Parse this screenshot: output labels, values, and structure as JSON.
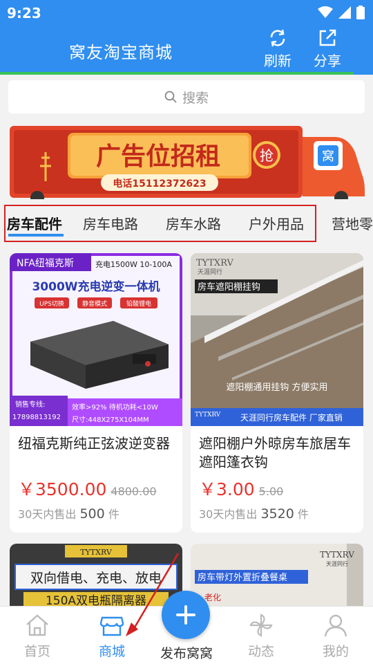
{
  "status": {
    "time": "9:23"
  },
  "header": {
    "title": "窝友淘宝商城",
    "refresh_label": "刷新",
    "share_label": "分享"
  },
  "search": {
    "placeholder": "搜索"
  },
  "banner": {
    "headline": "广告位招租",
    "phone": "电话15112372623",
    "grab": "抢",
    "badge": "窝"
  },
  "categories": [
    "房车配件",
    "房车电路",
    "房车水路",
    "户外用品",
    "营地零"
  ],
  "products": [
    {
      "title": "纽福克斯纯正弦波逆变器",
      "price": "￥3500.00",
      "original_price": "4800.00",
      "sold_prefix": "30天内售出",
      "sold_count": "500",
      "sold_unit": "件",
      "img": {
        "brand": "NFA纽福克斯",
        "spec": "充电1500W 10-100A",
        "headline": "3000W充电逆变一体机",
        "tags": [
          "UPS切换",
          "静音模式",
          "铅酸锂电"
        ],
        "hotline_label": "销售专线:",
        "hotline": "17898813192",
        "efficiency": "效率>92%   待机功耗<10W",
        "size": "尺寸:448X275X104MM"
      }
    },
    {
      "title": "遮阳棚户外晾房车旅居车遮阳篷衣钩",
      "price": "￥3.00",
      "original_price": "5.00",
      "sold_prefix": "30天内售出",
      "sold_count": "3520",
      "sold_unit": "件",
      "img": {
        "logo": "TYTXRV",
        "logo_sub": "天涯同行",
        "top_label": "房车遮阳棚挂钩",
        "caption": "遮阳棚通用挂钩  方便实用",
        "footer": "天涯同行房车配件 厂家直销"
      }
    },
    {
      "img": {
        "logo": "TYTXRV",
        "headline": "双向借电、充电、放电",
        "sub": "150A双电瓶隔离器"
      }
    },
    {
      "img": {
        "logo": "TYTXRV",
        "logo_sub": "天涯同行",
        "headline": "房车带灯外置折叠餐桌",
        "sub": "老化"
      }
    }
  ],
  "nav": {
    "home": "首页",
    "mall": "商城",
    "publish": "发布窝窝",
    "moments": "动态",
    "mine": "我的"
  },
  "colors": {
    "primary": "#2f8ef0",
    "price": "#e8332c",
    "highlight_box": "#d42020"
  }
}
